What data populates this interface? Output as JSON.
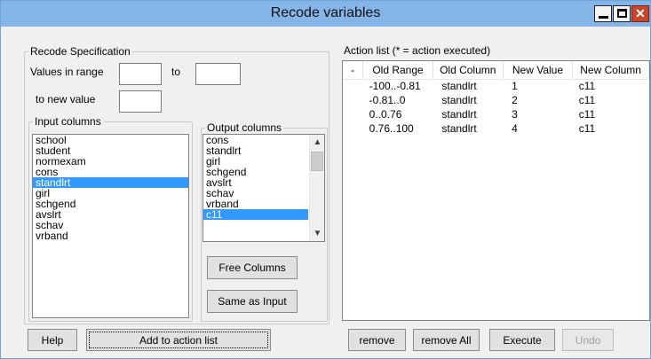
{
  "window": {
    "title": "Recode variables"
  },
  "recode_spec": {
    "legend": "Recode Specification",
    "values_in_range_label": "Values in range",
    "to_label": "to",
    "to_new_value_label": "to new value",
    "range_from_value": "",
    "range_to_value": "",
    "new_value": ""
  },
  "input_columns": {
    "legend": "Input columns",
    "items": [
      "school",
      "student",
      "normexam",
      "cons",
      "standlrt",
      "girl",
      "schgend",
      "avslrt",
      "schav",
      "vrband"
    ],
    "selected": "standlrt"
  },
  "output_columns": {
    "legend": "Output columns",
    "items": [
      "cons",
      "standlrt",
      "girl",
      "schgend",
      "avslrt",
      "schav",
      "vrband",
      "c11"
    ],
    "selected": "c11"
  },
  "buttons": {
    "free_columns": "Free Columns",
    "same_as_input": "Same as Input",
    "help": "Help",
    "add_to_action_list": "Add to action list",
    "remove": "remove",
    "remove_all": "remove All",
    "execute": "Execute",
    "undo": "Undo"
  },
  "action_list": {
    "legend": "Action list (* = action executed)",
    "columns": [
      "-",
      "Old Range",
      "Old Column",
      "New Value",
      "New Column"
    ],
    "rows": [
      {
        "marker": "",
        "old_range": "-100..-0.81",
        "old_column": "standlrt",
        "new_value": "1",
        "new_column": "c11"
      },
      {
        "marker": "",
        "old_range": "-0.81..0",
        "old_column": "standlrt",
        "new_value": "2",
        "new_column": "c11"
      },
      {
        "marker": "",
        "old_range": "0..0.76",
        "old_column": "standlrt",
        "new_value": "3",
        "new_column": "c11"
      },
      {
        "marker": "",
        "old_range": "0.76..100",
        "old_column": "standlrt",
        "new_value": "4",
        "new_column": "c11"
      }
    ]
  }
}
